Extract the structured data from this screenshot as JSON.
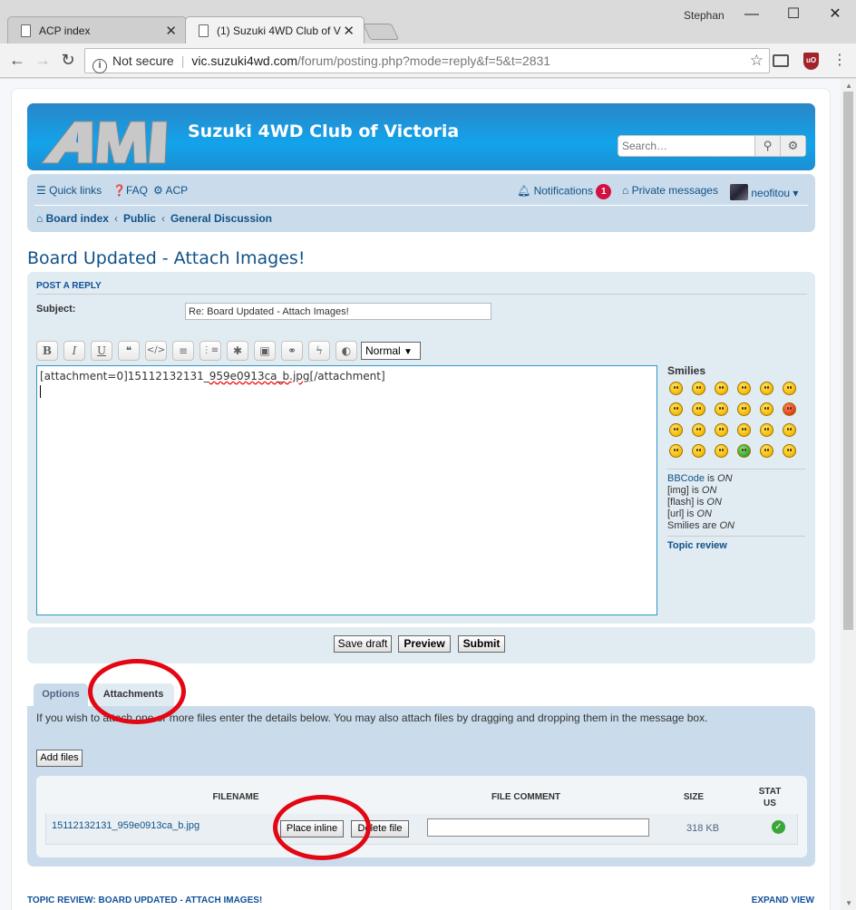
{
  "browser": {
    "tabs": [
      {
        "title": "ACP index",
        "active": false
      },
      {
        "title": "(1) Suzuki 4WD Club of V",
        "active": true
      }
    ],
    "window_user": "Stephan",
    "security_label": "Not secure",
    "url_host": "vic.suzuki4wd.com",
    "url_path": "/forum/posting.php?mode=reply&f=5&t=2831"
  },
  "header": {
    "site_title": "Suzuki 4WD Club of Victoria",
    "search_placeholder": "Search…",
    "brand_color": "#12a3eb"
  },
  "navbar": {
    "quick_links": "Quick links",
    "faq": "FAQ",
    "acp": "ACP",
    "notifications": "Notifications",
    "notification_count": "1",
    "private_messages": "Private messages",
    "username": "neofitou",
    "breadcrumbs": [
      "Board index",
      "Public",
      "General Discussion"
    ]
  },
  "page": {
    "title": "Board Updated - Attach Images!"
  },
  "post": {
    "heading": "POST A REPLY",
    "subject_label": "Subject:",
    "subject_value": "Re: Board Updated - Attach Images!",
    "font_size_selected": "Normal",
    "editor_prefix": "[attachment=0]15112132131_",
    "editor_misspelled": "959e0913ca_b.jpg",
    "editor_suffix": "[/attachment]",
    "formatting_buttons": [
      "B",
      "I",
      "U",
      "❝",
      "</>",
      "≡",
      "⋮≡",
      "✱",
      "▣",
      "⚭",
      "ϟ",
      "◐"
    ]
  },
  "smilies": {
    "title": "Smilies",
    "count": 24,
    "bbcode_link": "BBCode",
    "bbcode_text": " is ",
    "on": "ON",
    "img_text": "[img] is ",
    "flash_text": "[flash] is ",
    "url_text": "[url] is ",
    "smilies_text": "Smilies are ",
    "topic_review": "Topic review"
  },
  "buttons": {
    "save_draft": "Save draft",
    "preview": "Preview",
    "submit": "Submit"
  },
  "tabs": {
    "options": "Options",
    "attachments": "Attachments"
  },
  "attachments": {
    "info": "If you wish to attach one or more files enter the details below. You may also attach files by dragging and dropping them in the message box.",
    "add_files": "Add files",
    "columns": {
      "filename": "FILENAME",
      "comment": "FILE COMMENT",
      "size": "SIZE",
      "status": "STAT US"
    },
    "file": {
      "name": "15112132131_959e0913ca_b.jpg",
      "place_inline": "Place inline",
      "delete_file": "Delete file",
      "size": "318 KB"
    }
  },
  "topic_review": {
    "heading": "TOPIC REVIEW: BOARD UPDATED - ATTACH IMAGES!",
    "expand": "EXPAND VIEW"
  },
  "annotation_color": "#e30613"
}
